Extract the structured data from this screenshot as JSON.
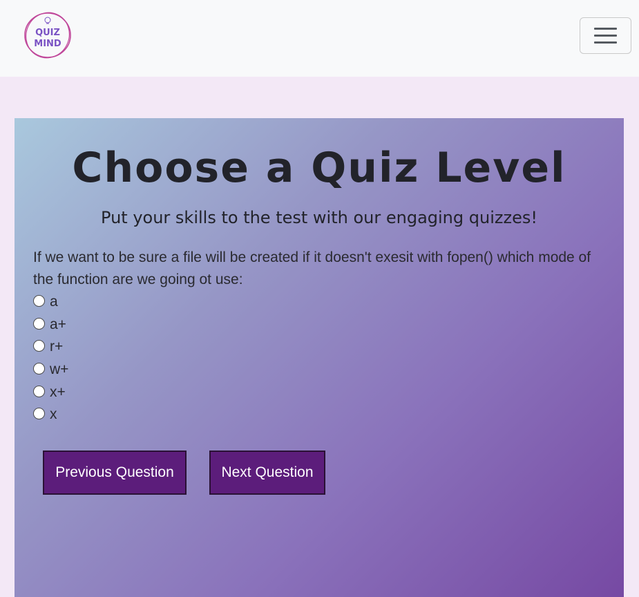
{
  "navbar": {
    "logo_line1": "QUIZ",
    "logo_line2": "MIND",
    "menu_icon": "hamburger-menu-icon"
  },
  "quiz": {
    "title": "Choose a Quiz Level",
    "subtitle": "Put your skills to the test with our engaging quizzes!",
    "question": "If we want to be sure a file will be created if it doesn't exesit with fopen() which mode of the function are we going ot use:",
    "options": [
      "a",
      "a+",
      "r+",
      "w+",
      "x+",
      "x"
    ],
    "previous_label": "Previous Question",
    "next_label": "Next Question"
  },
  "colors": {
    "background": "#f3e8f6",
    "navbar": "#f8f9fa",
    "button": "#5c1d7b",
    "logo_accent": "#c0479a",
    "logo_text": "#7a52c4"
  }
}
